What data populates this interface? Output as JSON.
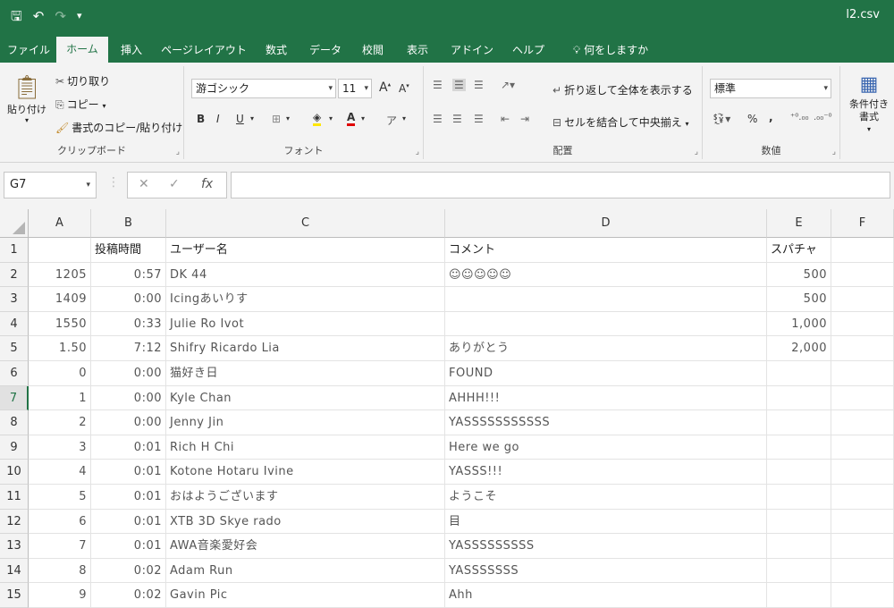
{
  "window": {
    "title": "l2.csv"
  },
  "qat": {
    "save_icon": "save-icon",
    "undo": "↶",
    "redo": "↷",
    "customize": "₹"
  },
  "tabs": [
    "ファイル",
    "ホーム",
    "挿入",
    "ページレイアウト",
    "数式",
    "データ",
    "校閲",
    "表示",
    "アドイン",
    "ヘルプ",
    "何をしますか"
  ],
  "ribbon": {
    "clipboard": {
      "paste": "貼り付け",
      "cut": "切り取り",
      "copy": "コピー",
      "format_painter": "書式のコピー/貼り付け",
      "label": "クリップボード"
    },
    "font": {
      "name": "游ゴシック",
      "size": "11",
      "bold": "B",
      "italic": "I",
      "underline": "U",
      "grow": "A",
      "shrink": "A",
      "label": "フォント"
    },
    "alignment": {
      "wrap": "折り返して全体を表示する",
      "merge": "セルを結合して中央揃え",
      "label": "配置"
    },
    "number": {
      "format": "標準",
      "percent": "%",
      "comma": ",",
      "label": "数値"
    },
    "styles": {
      "conditional": "条件付き書式"
    }
  },
  "formula": {
    "namebox": "G7",
    "cancel": "✕",
    "enter": "✓",
    "fx": "fx",
    "value": ""
  },
  "columns": [
    "A",
    "B",
    "C",
    "D",
    "E",
    "F"
  ],
  "rows": [
    {
      "n": "1",
      "a": "",
      "b": "投稿時間",
      "c": "ユーザー名",
      "d": "コメント",
      "e": "スパチャ"
    },
    {
      "n": "2",
      "a": "1205",
      "b": "0:57",
      "c": "DK 44",
      "d": "☺☺☺☺☺",
      "e": "500"
    },
    {
      "n": "3",
      "a": "1409",
      "b": "0:00",
      "c": "Icingあいりす",
      "d": "",
      "e": "500"
    },
    {
      "n": "4",
      "a": "1550",
      "b": "0:33",
      "c": "Julie Ro Ivot",
      "d": "",
      "e": "1,000"
    },
    {
      "n": "5",
      "a": "1.50",
      "b": "7:12",
      "c": "Shifry Ricardo Lia",
      "d": "ありがとう",
      "e": "2,000"
    },
    {
      "n": "6",
      "a": "0",
      "b": "0:00",
      "c": "猫好き日",
      "d": "FOUND",
      "e": ""
    },
    {
      "n": "7",
      "a": "1",
      "b": "0:00",
      "c": "Kyle Chan",
      "d": "AHHH!!!",
      "e": ""
    },
    {
      "n": "8",
      "a": "2",
      "b": "0:00",
      "c": "Jenny Jin",
      "d": "YASSSSSSSSSSS",
      "e": ""
    },
    {
      "n": "9",
      "a": "3",
      "b": "0:01",
      "c": "Rich H Chi",
      "d": "Here we go",
      "e": ""
    },
    {
      "n": "10",
      "a": "4",
      "b": "0:01",
      "c": "Kotone Hotaru Ivine",
      "d": "YASSS!!!",
      "e": ""
    },
    {
      "n": "11",
      "a": "5",
      "b": "0:01",
      "c": "おはようございます",
      "d": "ようこそ",
      "e": ""
    },
    {
      "n": "12",
      "a": "6",
      "b": "0:01",
      "c": "XTB 3D Skye rado",
      "d": "目",
      "e": ""
    },
    {
      "n": "13",
      "a": "7",
      "b": "0:01",
      "c": "AWA音楽愛好会",
      "d": "YASSSSSSSSS",
      "e": ""
    },
    {
      "n": "14",
      "a": "8",
      "b": "0:02",
      "c": "Adam Run",
      "d": "YASSSSSSS",
      "e": ""
    },
    {
      "n": "15",
      "a": "9",
      "b": "0:02",
      "c": "Gavin Pic",
      "d": "Ahh",
      "e": ""
    }
  ]
}
